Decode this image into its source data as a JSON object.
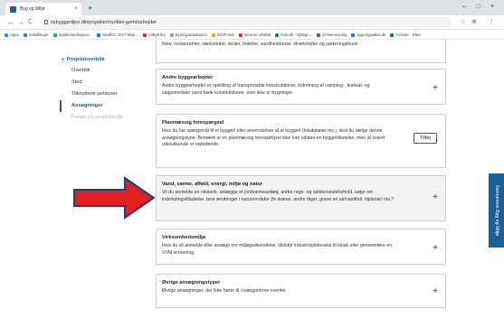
{
  "browser": {
    "tab_title": "Byg og Miljø",
    "tab_close": "×",
    "new_tab": "+",
    "window_controls": [
      "–",
      "□",
      "×"
    ],
    "url": "nybyggeriljoe.dk/projekter/ny/ikke-gemt/arbejder",
    "nav": {
      "back": "←",
      "forward": "→",
      "reload": "C"
    },
    "right_icons": [
      "☆",
      "⊕",
      "⋮"
    ],
    "bookmarks": [
      {
        "label": "Apps",
        "color": "#4285f4"
      },
      {
        "label": "Indstillinger",
        "color": "#3a7bd5"
      },
      {
        "label": "Spildevandsspeci...",
        "color": "#34a853"
      },
      {
        "label": "Vandfisc 2017-Mijø...",
        "color": "#1a73e8"
      },
      {
        "label": "CitByErhv",
        "color": "#d93025"
      },
      {
        "label": "Byningsdatabasen",
        "color": "#9aa0a6"
      },
      {
        "label": "EnvPortal",
        "color": "#f9ab00"
      },
      {
        "label": "Intranet UlmMa",
        "color": "#d93025"
      },
      {
        "label": "Kvik.dk - Oplagn...",
        "color": "#1e8e3e"
      },
      {
        "label": "Erhvervsvning",
        "color": "#5f6368"
      },
      {
        "label": "bygningsatlas.dk",
        "color": "#1a73e8"
      },
      {
        "label": "Forside - DMA",
        "color": "#188038"
      }
    ]
  },
  "top_partial": {
    "text": "fiske, restauranter, værksteder, skoler, hoteller, sundhedshuse, idrætshaller og parkeringshuse"
  },
  "sidebar": {
    "heading": "Projektoverblik",
    "heading_chevron": "v",
    "items": [
      {
        "label": "Overblik",
        "state": "normal"
      },
      {
        "label": "Sted",
        "state": "normal"
      },
      {
        "label": "Tilknyttede personer",
        "state": "normal"
      },
      {
        "label": "Ansøgninger",
        "state": "active"
      },
      {
        "label": "Forløb på projektforslik",
        "state": "disabled"
      }
    ]
  },
  "cards": [
    {
      "title": "Andre byggearbejder",
      "desc": "Andre byggearbejder er opstilling af transportable konstruktioner, indretning af camping-, festival- og salgsområder samt faste konstruktioner, som ikke er bygninger."
    },
    {
      "title": "Planmæssig forespørgsel",
      "desc": "Hvis du har spørgsmål til et byggeri eller anvendelsen af et byggeri (lokalplaner mv.), skal du vælge denne ansøgningstype. Bemærk at en planmæssig forespørgsel ikke kan udløse en byggetilladelse, men at svaret udelukkende er vejledende.",
      "button": "Tilføj"
    },
    {
      "title": "Vand, varme, affald, energi, miljø og natur",
      "desc": "Vil du anmelde en olietank, anlægge et jordvarmeanlæg, andre regn- og spildevandsforhold, søge om indvindingstilladelse, lave ændringer i naturområder (fx dræne, andre diger, grave en sø/vandhul, tilplante) mv.?"
    },
    {
      "title": "Virksomhedsmiljø",
      "desc": "Hvis du vil anmelde eller ansøge om miljøgodkendelse, tilsluttе industrispildevand til kloak eller gennemføre en VVM screening"
    },
    {
      "title": "Øvrige ansøgningstyper",
      "desc": "Øvrige ansøgninger, der ikke hører til i kategorierne ovenfor."
    }
  ],
  "plus_label": "+",
  "feedback_tab": "Gennemse Byg og Miljø",
  "colors": {
    "accent": "#1a5e95",
    "arrow_fill": "#e4201f",
    "arrow_outline": "#1f3c88"
  }
}
